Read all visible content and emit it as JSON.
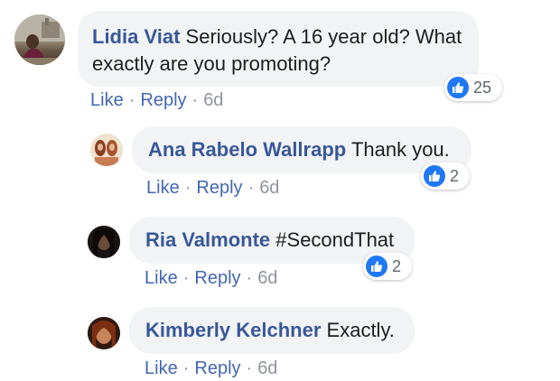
{
  "colors": {
    "author": "#385898",
    "link": "#4267b2",
    "meta": "#90949c",
    "bubble": "#f2f3f5",
    "like_blue": "#2078f4"
  },
  "comments": [
    {
      "author": "Lidia Viat",
      "text_line1": "Seriously? A 16 year old? What",
      "text_line2": "exactly are you promoting?",
      "like": "Like",
      "reply": "Reply",
      "time": "6d",
      "reaction_icon": "thumbs-up-icon",
      "reaction_count": "25"
    },
    {
      "author": "Ana Rabelo Wallrapp",
      "text": "Thank you.",
      "like": "Like",
      "reply": "Reply",
      "time": "6d",
      "reaction_icon": "thumbs-up-icon",
      "reaction_count": "2"
    },
    {
      "author": "Ria Valmonte",
      "text": "#SecondThat",
      "like": "Like",
      "reply": "Reply",
      "time": "6d",
      "reaction_icon": "thumbs-up-icon",
      "reaction_count": "2"
    },
    {
      "author": "Kimberly Kelchner",
      "text": "Exactly.",
      "like": "Like",
      "reply": "Reply",
      "time": "6d"
    }
  ]
}
